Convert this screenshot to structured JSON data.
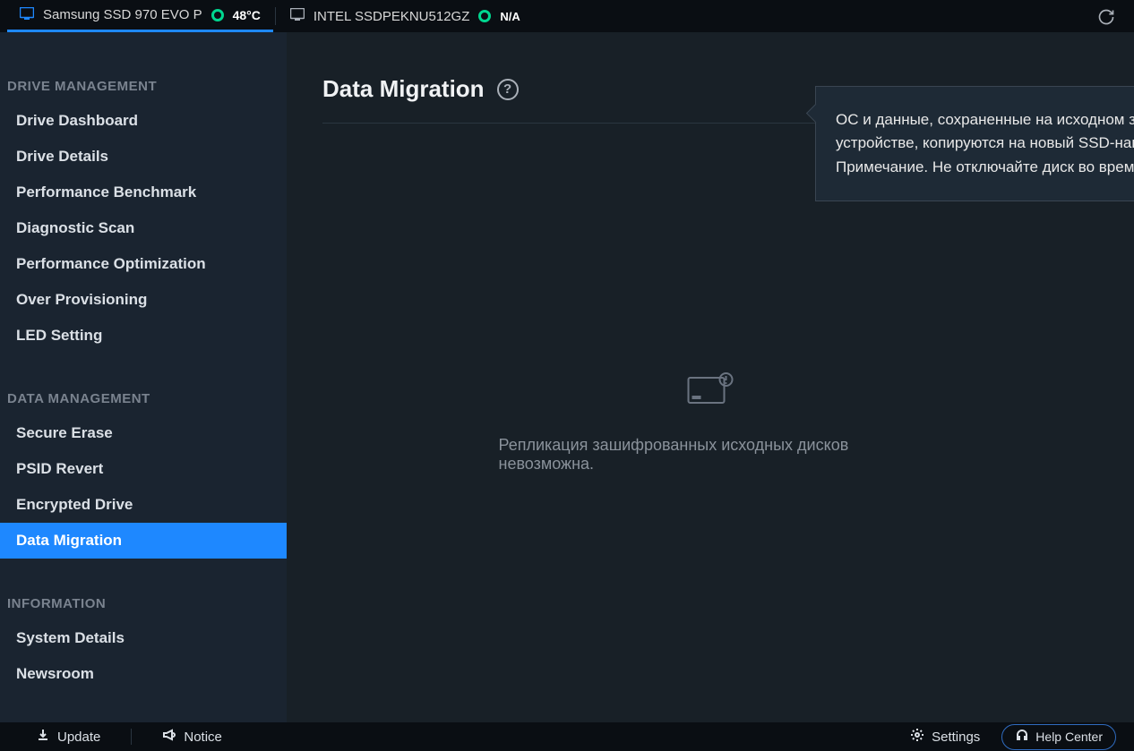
{
  "topbar": {
    "drives": [
      {
        "name": "Samsung SSD 970 EVO P",
        "temp": "48°C",
        "na": "",
        "active": true
      },
      {
        "name": "INTEL SSDPEKNU512GZ",
        "temp": "",
        "na": "N/A",
        "active": false
      }
    ]
  },
  "sidebar": {
    "groups": [
      {
        "title": "DRIVE MANAGEMENT",
        "items": [
          {
            "label": "Drive Dashboard",
            "active": false
          },
          {
            "label": "Drive Details",
            "active": false
          },
          {
            "label": "Performance Benchmark",
            "active": false
          },
          {
            "label": "Diagnostic Scan",
            "active": false
          },
          {
            "label": "Performance Optimization",
            "active": false
          },
          {
            "label": "Over Provisioning",
            "active": false
          },
          {
            "label": "LED Setting",
            "active": false
          }
        ]
      },
      {
        "title": "DATA MANAGEMENT",
        "items": [
          {
            "label": "Secure Erase",
            "active": false
          },
          {
            "label": "PSID Revert",
            "active": false
          },
          {
            "label": "Encrypted Drive",
            "active": false
          },
          {
            "label": "Data Migration",
            "active": true
          }
        ]
      },
      {
        "title": "INFORMATION",
        "items": [
          {
            "label": "System Details",
            "active": false
          },
          {
            "label": "Newsroom",
            "active": false
          }
        ]
      }
    ]
  },
  "page": {
    "title": "Data Migration",
    "tooltip": "ОС и данные, сохраненные на исходном запоминающем устройстве, копируются на новый SSD-накопитель Samsung. Примечание. Не отключайте диск во время клонирования.",
    "emptyMessage": "Репликация зашифрованных исходных дисков невозможна."
  },
  "bottombar": {
    "update": "Update",
    "notice": "Notice",
    "settings": "Settings",
    "helpCenter": "Help Center"
  }
}
